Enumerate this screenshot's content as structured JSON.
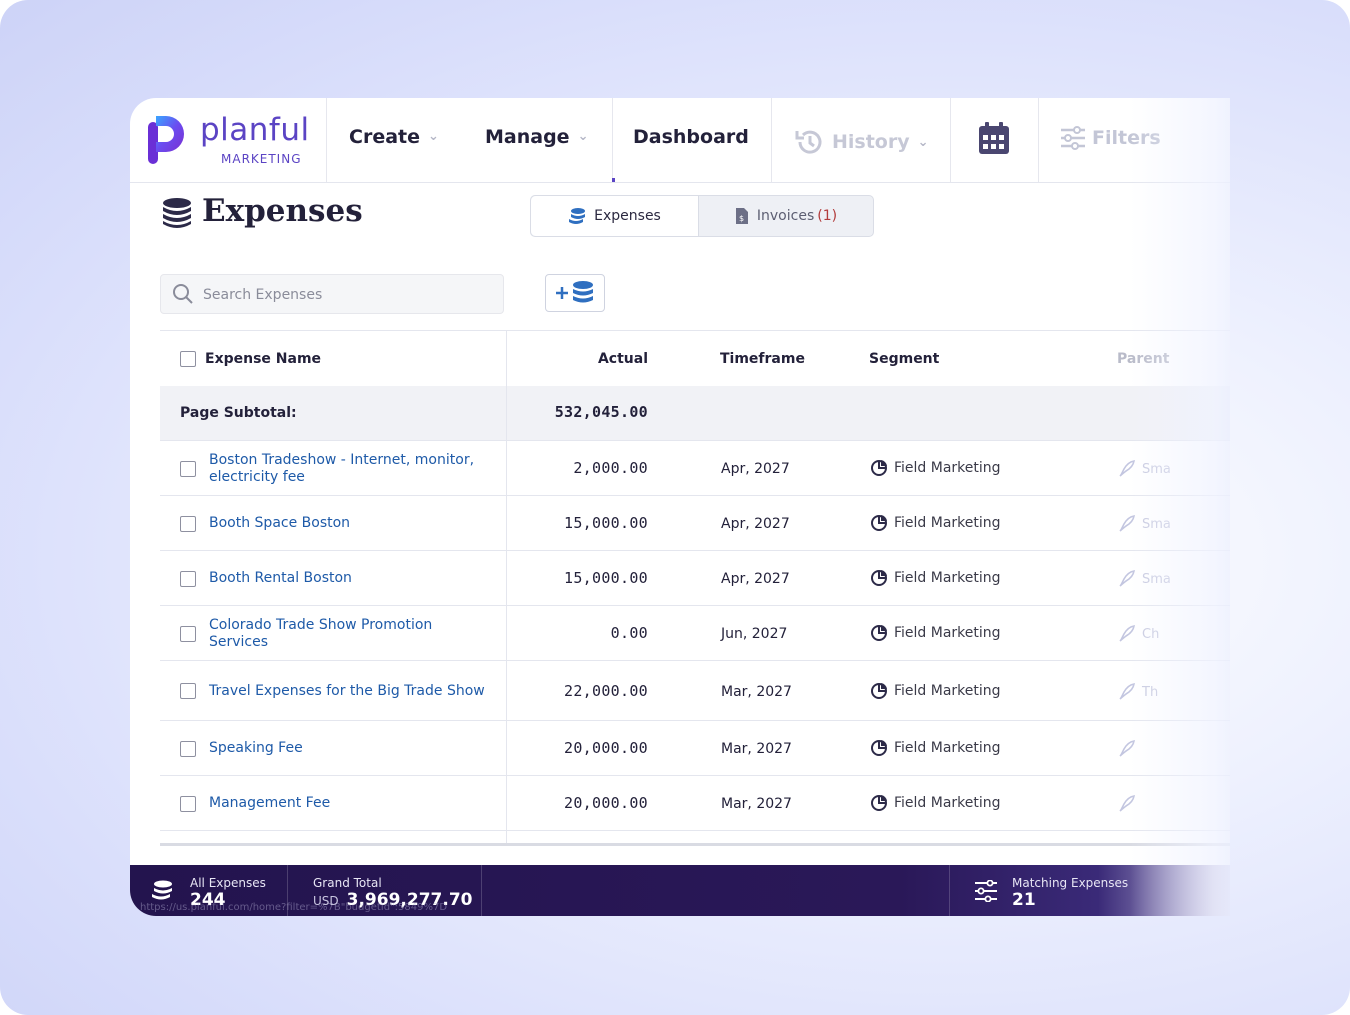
{
  "brand": {
    "name": "planful",
    "sub": "MARKETING"
  },
  "nav": {
    "create": "Create",
    "manage": "Manage",
    "dashboard": "Dashboard",
    "history": "History",
    "filters": "Filters"
  },
  "page": {
    "title": "Expenses",
    "tabs": [
      {
        "label": "Expenses",
        "count": ""
      },
      {
        "label": "Invoices",
        "count": "(1)"
      }
    ],
    "search_placeholder": "Search Expenses"
  },
  "table": {
    "columns": [
      "Expense Name",
      "Actual",
      "Timeframe",
      "Segment",
      "Parent"
    ],
    "subtotal_label": "Page Subtotal:",
    "subtotal_value": "532,045.00",
    "rows": [
      {
        "name": "Boston Tradeshow - Internet, monitor, electricity fee",
        "actual": "2,000.00",
        "timeframe": "Apr, 2027",
        "segment": "Field Marketing",
        "parent": "Sma"
      },
      {
        "name": "Booth Space Boston",
        "actual": "15,000.00",
        "timeframe": "Apr, 2027",
        "segment": "Field Marketing",
        "parent": "Sma"
      },
      {
        "name": "Booth Rental Boston",
        "actual": "15,000.00",
        "timeframe": "Apr, 2027",
        "segment": "Field Marketing",
        "parent": "Sma"
      },
      {
        "name": "Colorado Trade Show Promotion Services",
        "actual": "0.00",
        "timeframe": "Jun, 2027",
        "segment": "Field Marketing",
        "parent": "Ch"
      },
      {
        "name": "Travel Expenses for the Big Trade Show",
        "actual": "22,000.00",
        "timeframe": "Mar, 2027",
        "segment": "Field Marketing",
        "parent": "Th"
      },
      {
        "name": "Speaking Fee",
        "actual": "20,000.00",
        "timeframe": "Mar, 2027",
        "segment": "Field Marketing",
        "parent": ""
      },
      {
        "name": "Management Fee",
        "actual": "20,000.00",
        "timeframe": "Mar, 2027",
        "segment": "Field Marketing",
        "parent": ""
      }
    ]
  },
  "footer": {
    "all_expenses_label": "All Expenses",
    "all_expenses_value": "244",
    "grand_total_label": "Grand Total",
    "grand_total_currency": "USD",
    "grand_total_value": "3,969,277.70",
    "matching_label": "Matching Expenses",
    "matching_value": "21",
    "status_url": "https://us.planful.com/home?filter=%7B\"budgetId\":5849%7D"
  },
  "colors": {
    "brand": "#5b44c4",
    "link": "#1e5aa8",
    "footer": "#23144e"
  },
  "icons": [
    "coins-icon",
    "invoice-icon",
    "search-icon",
    "add-expense-icon",
    "history-icon",
    "calendar-icon",
    "filter-icon",
    "segment-pie-icon",
    "rocket-icon"
  ]
}
